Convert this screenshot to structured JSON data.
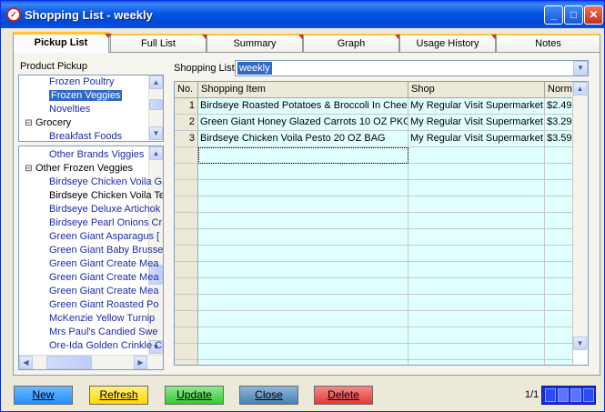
{
  "window": {
    "title": "Shopping List - weekly",
    "title_icon_glyph": "✓",
    "minimize": "_",
    "maximize": "□",
    "close": "✕"
  },
  "tabs": [
    {
      "label": "Pickup List",
      "active": true
    },
    {
      "label": "Full List",
      "active": false
    },
    {
      "label": "Summary",
      "active": false
    },
    {
      "label": "Graph",
      "active": false
    },
    {
      "label": "Usage History",
      "active": false
    },
    {
      "label": "Notes",
      "active": false
    }
  ],
  "product_pickup": {
    "label": "Product Pickup",
    "top_tree": [
      {
        "text": "Frozen Poultry",
        "kind": "link",
        "indent": 1,
        "expander": ""
      },
      {
        "text": "Frozen Veggies",
        "kind": "selected",
        "indent": 1,
        "expander": ""
      },
      {
        "text": "Novelties",
        "kind": "link",
        "indent": 1,
        "expander": ""
      },
      {
        "text": "Grocery",
        "kind": "plain",
        "indent": 0,
        "expander": "⊟"
      },
      {
        "text": "Breakfast Foods",
        "kind": "link",
        "indent": 1,
        "expander": ""
      }
    ],
    "bottom_tree": [
      {
        "text": "Other Brands Viggies",
        "kind": "link",
        "indent": 1,
        "expander": ""
      },
      {
        "text": "Other Frozen Veggies",
        "kind": "plain",
        "indent": 0,
        "expander": "⊟"
      },
      {
        "text": "Birdseye Chicken Voila Ga",
        "kind": "link",
        "indent": 1,
        "expander": ""
      },
      {
        "text": "Birdseye Chicken Voila Te",
        "kind": "plain",
        "indent": 1,
        "expander": ""
      },
      {
        "text": "Birdseye Deluxe Artichok",
        "kind": "link",
        "indent": 1,
        "expander": ""
      },
      {
        "text": "Birdseye Pearl Onions Cr",
        "kind": "link",
        "indent": 1,
        "expander": ""
      },
      {
        "text": "Green Giant Asparagus [",
        "kind": "link",
        "indent": 1,
        "expander": ""
      },
      {
        "text": "Green Giant Baby Brusse",
        "kind": "link",
        "indent": 1,
        "expander": ""
      },
      {
        "text": "Green Giant Create Mea",
        "kind": "link",
        "indent": 1,
        "expander": ""
      },
      {
        "text": "Green Giant Create Mea",
        "kind": "link",
        "indent": 1,
        "expander": ""
      },
      {
        "text": "Green Giant Create Mea",
        "kind": "link",
        "indent": 1,
        "expander": ""
      },
      {
        "text": "Green Giant Roasted Po",
        "kind": "link",
        "indent": 1,
        "expander": ""
      },
      {
        "text": "McKenzie Yellow Turnip",
        "kind": "link",
        "indent": 1,
        "expander": ""
      },
      {
        "text": "Mrs Paul's Candied Swe",
        "kind": "link",
        "indent": 1,
        "expander": ""
      },
      {
        "text": "Ore-Ida Golden Crinkle C",
        "kind": "link",
        "indent": 1,
        "expander": ""
      }
    ]
  },
  "shopping_list": {
    "label": "Shopping List:",
    "value": "weekly"
  },
  "grid": {
    "columns": [
      "No.",
      "Shopping Item",
      "Shop",
      "Norma"
    ],
    "rows": [
      {
        "no": "1",
        "item": "Birdseye Roasted Potatoes & Broccoli In Cheese Sa",
        "shop": "My Regular Visit Supermarket",
        "normal": "$2.49"
      },
      {
        "no": "2",
        "item": "Green Giant Honey Glazed Carrots  10 OZ PKG",
        "shop": "My Regular Visit Supermarket",
        "normal": "$3.29"
      },
      {
        "no": "3",
        "item": "Birdseye Chicken Voila Pesto  20 OZ BAG",
        "shop": "My Regular Visit Supermarket",
        "normal": "$3.59"
      }
    ],
    "empty_rows": 14
  },
  "buttons": [
    {
      "label": "New",
      "color": "#1e90ff"
    },
    {
      "label": "Refresh",
      "color": "#ffd700"
    },
    {
      "label": "Update",
      "color": "#32cd32"
    },
    {
      "label": "Close",
      "color": "#4682b4"
    },
    {
      "label": "Delete",
      "color": "#e53935"
    }
  ],
  "pager": {
    "text": "1/1"
  },
  "icons": {
    "scroll_up": "▲",
    "scroll_down": "▼",
    "scroll_left": "◀",
    "scroll_right": "▶",
    "combo": "▼"
  }
}
